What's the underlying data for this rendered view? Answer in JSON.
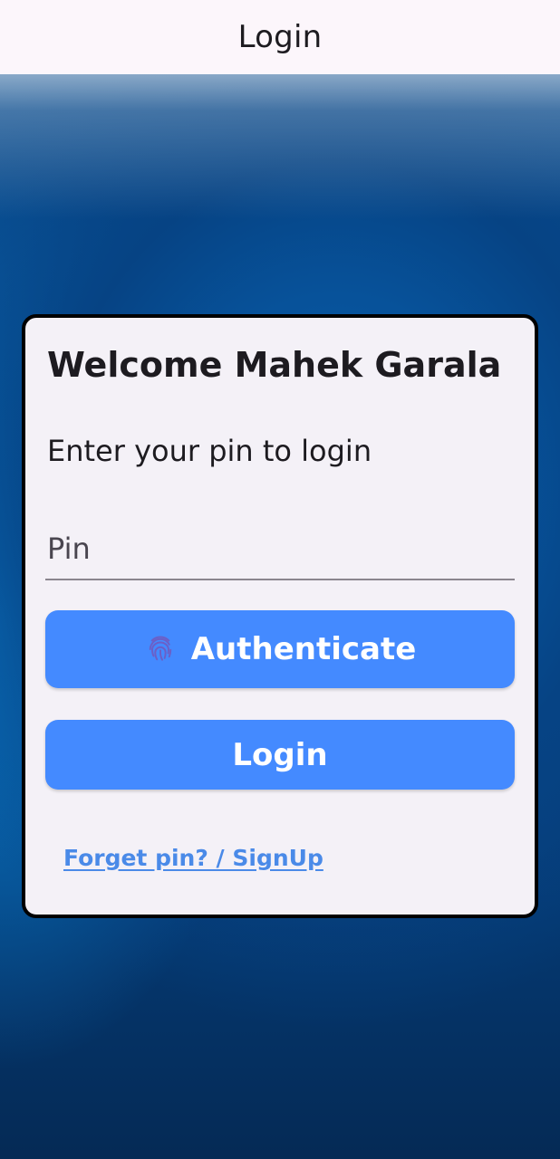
{
  "app_bar": {
    "title": "Login"
  },
  "card": {
    "welcome": "Welcome Mahek Garala",
    "subtitle": "Enter your pin to login",
    "pin_field": {
      "placeholder": "Pin",
      "value": ""
    },
    "authenticate_button": {
      "label": "Authenticate",
      "icon": "fingerprint-icon"
    },
    "login_button": {
      "label": "Login"
    },
    "forgot_link": "Forget pin? / SignUp"
  },
  "colors": {
    "app_bar_bg": "#fcf6fb",
    "card_bg": "#f4f1f7",
    "button_bg": "#448aff",
    "link": "#4a8ae8",
    "fingerprint_icon": "#6b5fc7"
  }
}
